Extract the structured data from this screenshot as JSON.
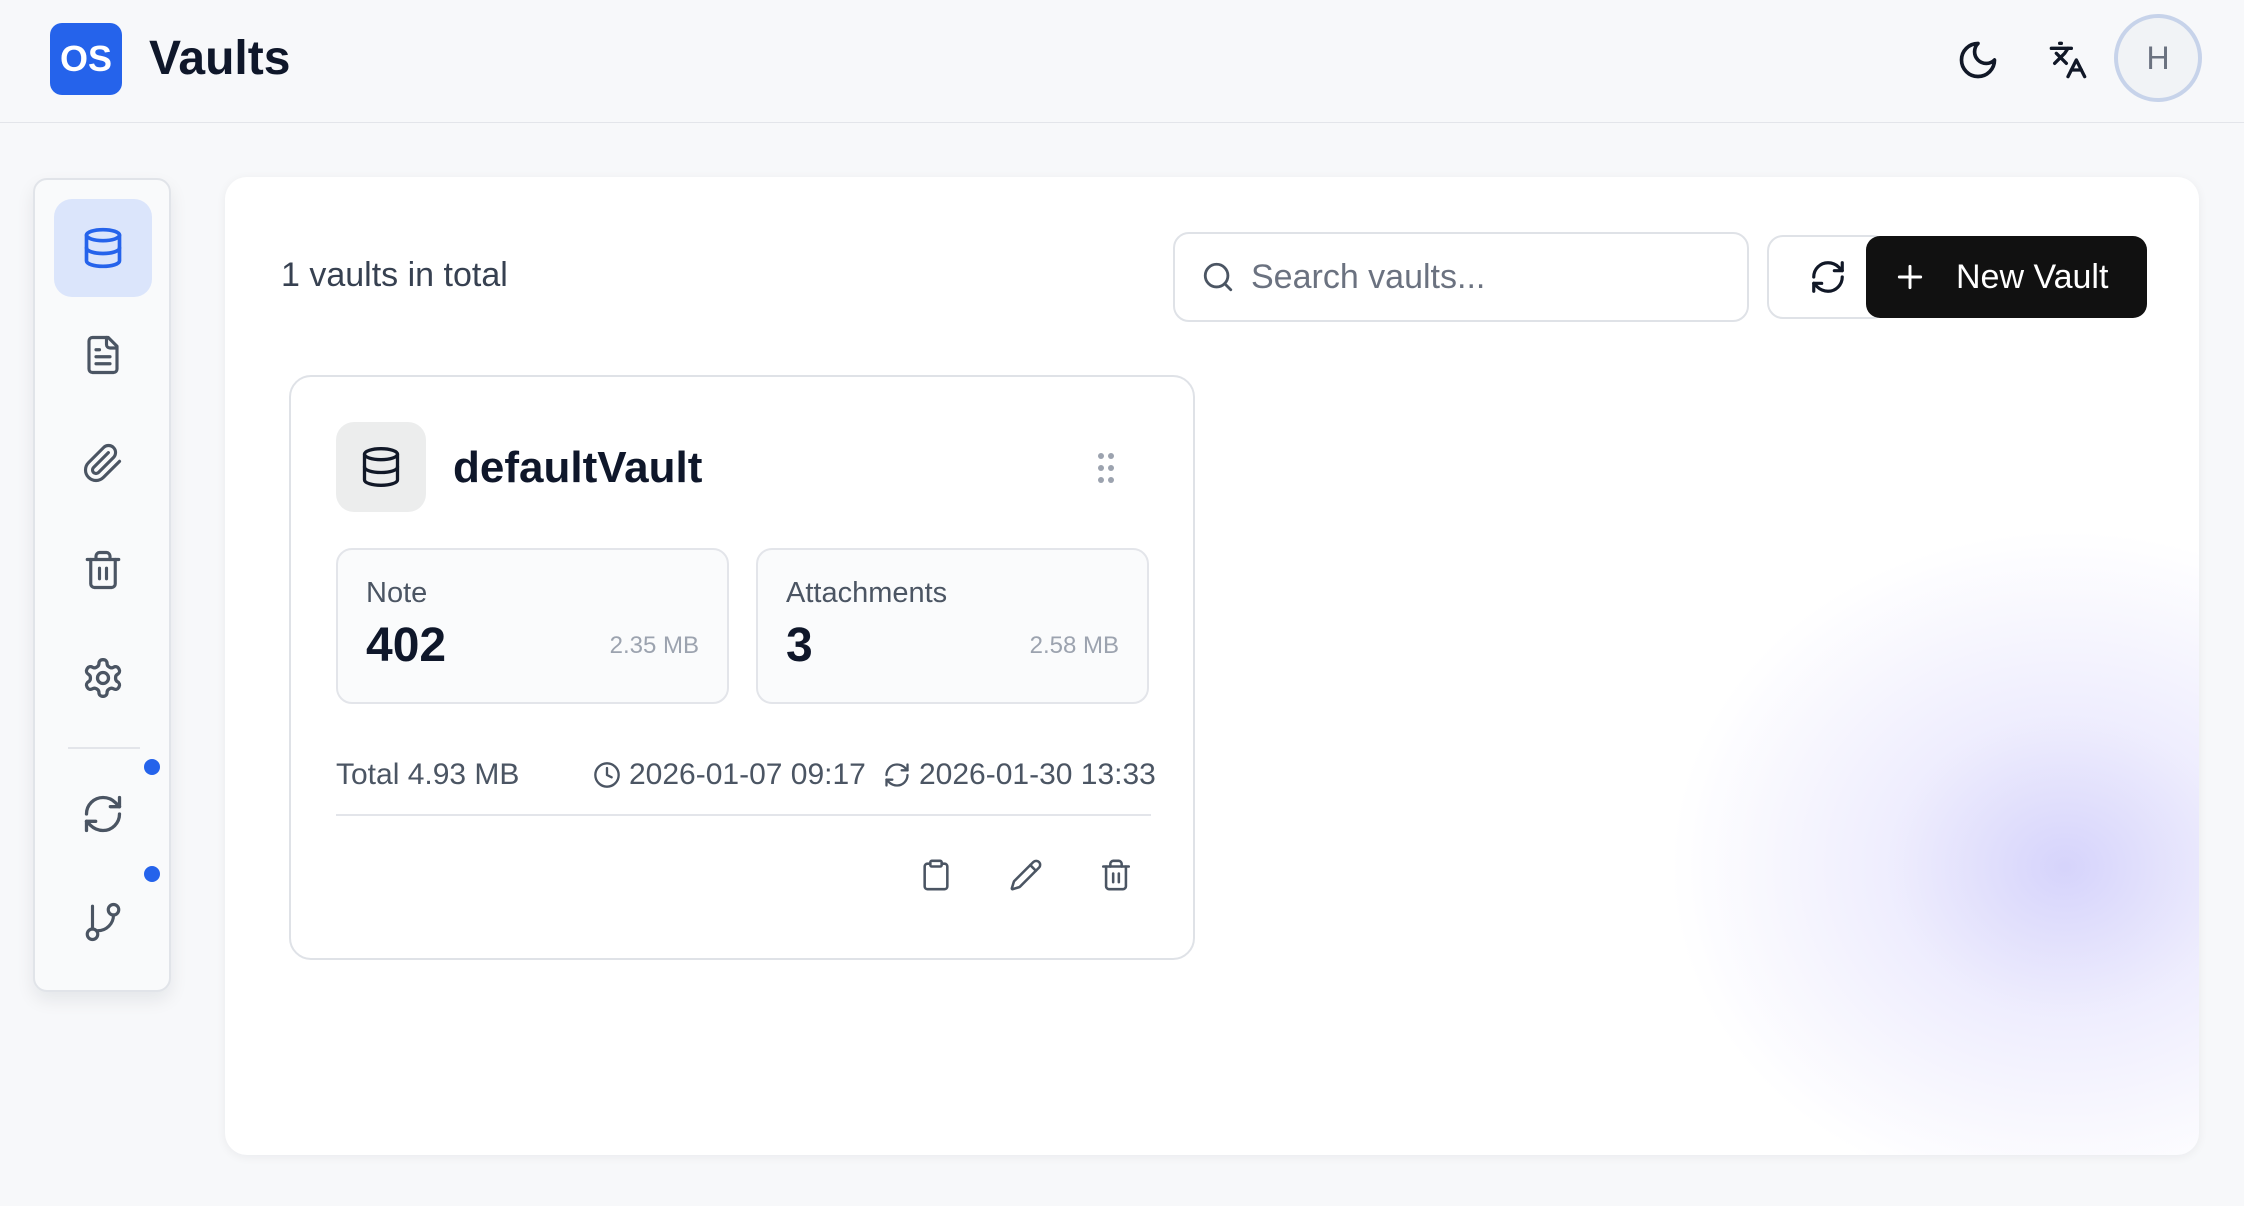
{
  "app": {
    "logo_text": "OS",
    "title": "Vaults"
  },
  "header": {
    "theme_toggle_icon": "moon-icon",
    "language_icon": "translate-icon",
    "avatar_initial": "H"
  },
  "sidebar": {
    "items": [
      {
        "name": "vaults",
        "icon": "database-icon",
        "active": true
      },
      {
        "name": "notes",
        "icon": "file-text-icon",
        "active": false
      },
      {
        "name": "attachments",
        "icon": "paperclip-icon",
        "active": false
      },
      {
        "name": "trash",
        "icon": "trash-icon",
        "active": false
      },
      {
        "name": "settings",
        "icon": "gear-icon",
        "active": false
      },
      {
        "name": "sync",
        "icon": "refresh-icon",
        "active": false,
        "badge": true
      },
      {
        "name": "git",
        "icon": "git-branch-icon",
        "active": false,
        "badge": true
      }
    ]
  },
  "toolbar": {
    "total_text": "1 vaults in total",
    "search_placeholder": "Search vaults...",
    "new_vault_label": "New Vault"
  },
  "vaults": [
    {
      "name": "defaultVault",
      "note_label": "Note",
      "note_count": "402",
      "note_size": "2.35 MB",
      "attachments_label": "Attachments",
      "attachments_count": "3",
      "attachments_size": "2.58 MB",
      "total": "Total 4.93 MB",
      "created": "2026-01-07 09:17",
      "updated": "2026-01-30 13:33"
    }
  ],
  "colors": {
    "brand": "#2563eb",
    "active_bg": "#dbe5fb",
    "primary_button": "#111111",
    "badge": "#2563eb"
  }
}
